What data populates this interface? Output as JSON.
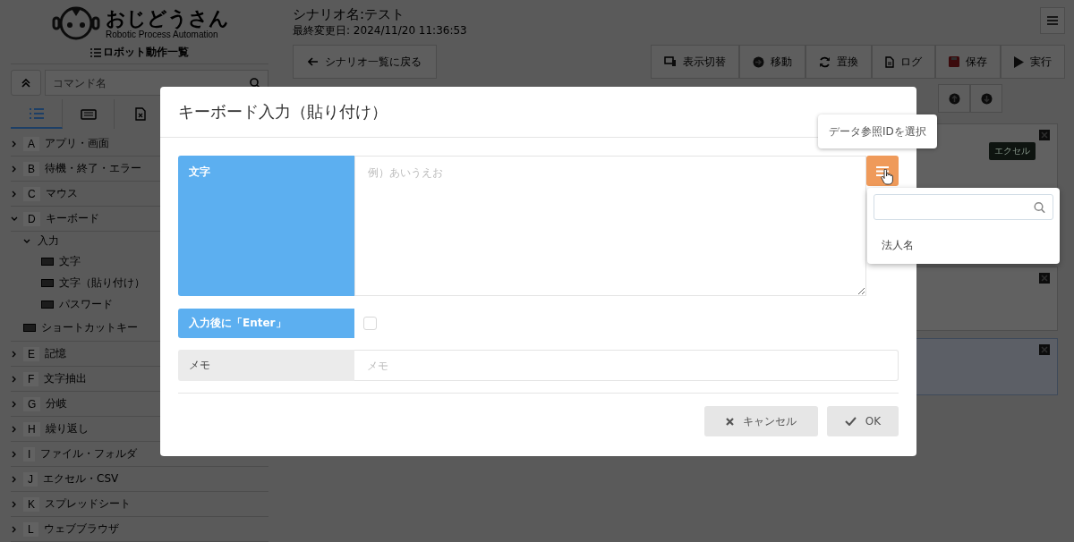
{
  "app": {
    "logo_name": "おじどうさん",
    "logo_tagline": "Robotic Process Automation"
  },
  "sidebar": {
    "title": "ロボット動作一覧",
    "search": {
      "placeholder": "コマンド名"
    },
    "tabs": [
      {
        "kind": "list",
        "selected": true
      },
      {
        "kind": "keyboard",
        "selected": false
      },
      {
        "kind": "excel",
        "selected": false
      }
    ],
    "categories": [
      {
        "letter": "A",
        "label": "アプリ・画面",
        "expanded": false
      },
      {
        "letter": "B",
        "label": "待機・終了・エラー",
        "expanded": false
      },
      {
        "letter": "C",
        "label": "マウス",
        "expanded": false
      },
      {
        "letter": "D",
        "label": "キーボード",
        "expanded": true,
        "children": [
          {
            "label": "入力",
            "expanded": true,
            "children": [
              {
                "label": "文字"
              },
              {
                "label": "文字（貼り付け）"
              },
              {
                "label": "パスワード"
              }
            ]
          },
          {
            "label": "ショートカットキー"
          }
        ]
      },
      {
        "letter": "E",
        "label": "記憶",
        "expanded": false
      },
      {
        "letter": "F",
        "label": "文字抽出",
        "expanded": false
      },
      {
        "letter": "G",
        "label": "分岐",
        "expanded": false
      },
      {
        "letter": "H",
        "label": "繰り返し",
        "expanded": false
      },
      {
        "letter": "I",
        "label": "ファイル・フォルダ",
        "expanded": false
      },
      {
        "letter": "J",
        "label": "エクセル・CSV",
        "expanded": false
      },
      {
        "letter": "K",
        "label": "スプレッドシート",
        "expanded": false
      },
      {
        "letter": "L",
        "label": "ウェブブラウザ",
        "expanded": false
      }
    ]
  },
  "header": {
    "scenario_title": "シナリオ名:テスト",
    "last_modified": "最終変更日: 2024/11/20 11:36:53"
  },
  "toolbar": {
    "back_label": "シナリオ一覧に戻る",
    "actions": [
      {
        "kind": "display",
        "label": "表示切替"
      },
      {
        "kind": "move",
        "label": "移動"
      },
      {
        "kind": "replace",
        "label": "置換"
      },
      {
        "kind": "log",
        "label": "ログ"
      },
      {
        "kind": "save",
        "label": "保存"
      },
      {
        "kind": "run",
        "label": "実行"
      }
    ]
  },
  "cards": [
    {
      "badge": "エクセル",
      "closable": true
    },
    {
      "closable": true
    },
    {
      "closable": true
    }
  ],
  "modal": {
    "title": "キーボード入力（貼り付け）",
    "fields": [
      {
        "kind": "textarea",
        "label": "文字",
        "required": true,
        "placeholder": "例）あいうえお"
      },
      {
        "kind": "checkbox",
        "label": "入力後に「Enter」",
        "required": true,
        "checked": false
      },
      {
        "kind": "text",
        "label": "メモ",
        "required": false,
        "placeholder": "メモ"
      }
    ],
    "tooltip": "データ参照IDを選択",
    "dropdown": {
      "items": [
        "法人名"
      ]
    },
    "buttons": [
      {
        "kind": "cancel",
        "label": "キャンセル"
      },
      {
        "kind": "ok",
        "label": "OK"
      }
    ]
  }
}
